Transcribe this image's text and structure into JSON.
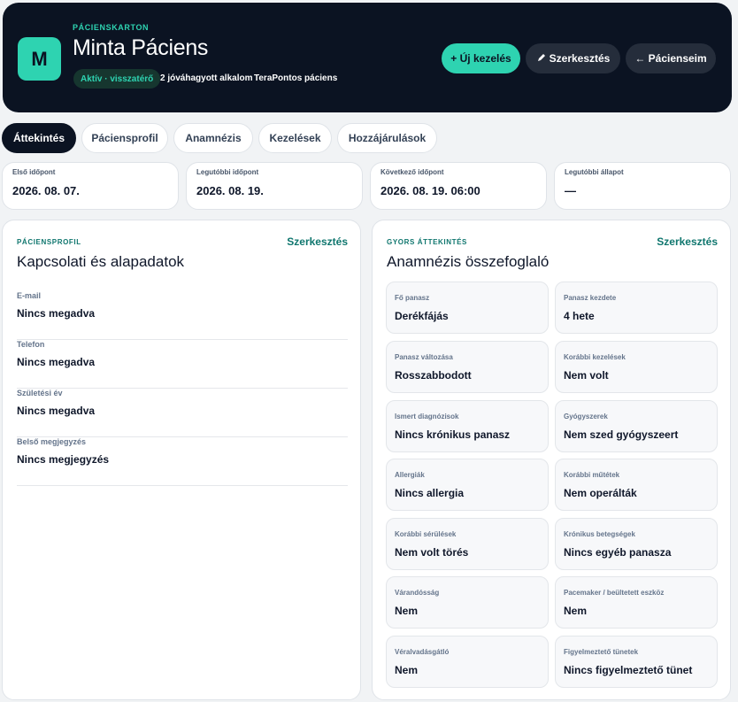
{
  "header": {
    "avatar_initial": "M",
    "eyebrow": "PÁCIENSKARTON",
    "name": "Minta Páciens",
    "status": "Aktív · visszatérő",
    "approved_sessions": "2 jóváhagyott alkalom",
    "source": "TeraPontos páciens",
    "buttons": {
      "new": "+ Új kezelés",
      "edit": "Szerkesztés",
      "back": "← Pácienseim"
    }
  },
  "tabs": [
    "Áttekintés",
    "Páciensprofil",
    "Anamnézis",
    "Kezelések",
    "Hozzájárulások"
  ],
  "stats": [
    {
      "label": "Első időpont",
      "value": "2026. 08. 07."
    },
    {
      "label": "Legutóbbi időpont",
      "value": "2026. 08. 19."
    },
    {
      "label": "Következő időpont",
      "value": "2026. 08. 19. 06:00"
    },
    {
      "label": "Legutóbbi állapot",
      "value": "—"
    }
  ],
  "profile": {
    "eyebrow": "PÁCIENSPROFIL",
    "edit": "Szerkesztés",
    "title": "Kapcsolati és alapadatok",
    "fields": [
      {
        "label": "E-mail",
        "value": "Nincs megadva"
      },
      {
        "label": "Telefon",
        "value": "Nincs megadva"
      },
      {
        "label": "Születési év",
        "value": "Nincs megadva"
      },
      {
        "label": "Belső megjegyzés",
        "value": "Nincs megjegyzés"
      }
    ]
  },
  "overview": {
    "eyebrow": "GYORS ÁTTEKINTÉS",
    "edit": "Szerkesztés",
    "title": "Anamnézis összefoglaló",
    "cards": [
      {
        "label": "Fő panasz",
        "value": "Derékfájás"
      },
      {
        "label": "Panasz kezdete",
        "value": "4 hete"
      },
      {
        "label": "Panasz változása",
        "value": "Rosszabbodott"
      },
      {
        "label": "Korábbi kezelések",
        "value": "Nem volt"
      },
      {
        "label": "Ismert diagnózisok",
        "value": "Nincs krónikus panasz"
      },
      {
        "label": "Gyógyszerek",
        "value": "Nem szed gyógyszeert"
      },
      {
        "label": "Allergiák",
        "value": "Nincs allergia"
      },
      {
        "label": "Korábbi műtétek",
        "value": "Nem operálták"
      },
      {
        "label": "Korábbi sérülések",
        "value": "Nem volt törés"
      },
      {
        "label": "Krónikus betegségek",
        "value": "Nincs egyéb panasza"
      },
      {
        "label": "Várandósság",
        "value": "Nem"
      },
      {
        "label": "Pacemaker / beültetett eszköz",
        "value": "Nem"
      },
      {
        "label": "Véralvadásgátló",
        "value": "Nem"
      },
      {
        "label": "Figyelmeztető tünetek",
        "value": "Nincs figyelmeztető tünet"
      }
    ]
  },
  "colors": {
    "accent": "#2ed3b1",
    "header_bg": "#0b1322",
    "link": "#0f766e"
  }
}
